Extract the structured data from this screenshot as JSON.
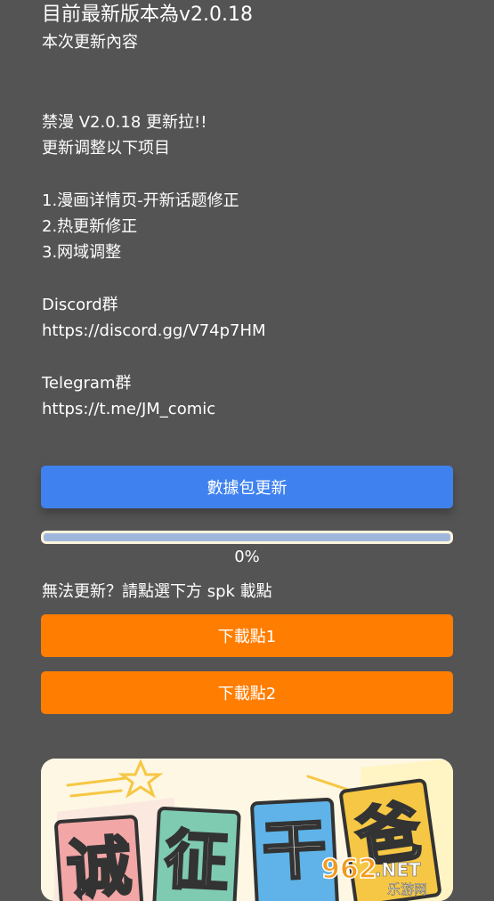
{
  "header": {
    "title": "目前最新版本為v2.0.18",
    "subtitle": "本次更新內容"
  },
  "notes": {
    "lines": [
      "禁漫 V2.0.18 更新拉!!",
      "更新调整以下项目",
      "",
      "1.漫画详情页-开新话题修正",
      "2.热更新修正",
      "3.网域调整",
      "",
      "Discord群",
      "https://discord.gg/V74p7HM",
      "",
      "Telegram群",
      "https://t.me/JM_comic"
    ]
  },
  "update_button": {
    "label": "數據包更新",
    "color": "#3f82ef"
  },
  "progress": {
    "value": 0,
    "label": "0%"
  },
  "hint": "無法更新？請點選下方 spk 載點",
  "download_buttons": [
    {
      "label": "下載點1",
      "color": "#ff7d00"
    },
    {
      "label": "下載點2",
      "color": "#ff7d00"
    }
  ],
  "banner": {
    "chars": [
      "诚",
      "征",
      "干",
      "爸"
    ],
    "char_colors": [
      "#f2a6a6",
      "#7ecbb2",
      "#5fb3e8",
      "#f6c744"
    ]
  },
  "watermark": {
    "brand": "962",
    "suffix": ".NET",
    "sub": "乐游网"
  }
}
